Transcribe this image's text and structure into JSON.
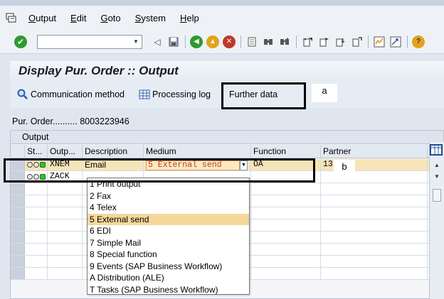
{
  "menu": {
    "items": [
      {
        "label": "Output",
        "u": "O",
        "rest": "utput"
      },
      {
        "label": "Edit",
        "u": "E",
        "rest": "dit"
      },
      {
        "label": "Goto",
        "u": "G",
        "rest": "oto"
      },
      {
        "label": "System",
        "u": "S",
        "rest": "ystem"
      },
      {
        "label": "Help",
        "u": "H",
        "rest": "elp"
      }
    ]
  },
  "toolbar": {
    "command_value": "",
    "icons": [
      "enter-icon",
      "back-icon",
      "save-icon",
      "back-nav-icon",
      "exit-icon",
      "cancel-icon",
      "print-icon",
      "find-icon",
      "find-next-icon",
      "first-page-icon",
      "previous-page-icon",
      "next-page-icon",
      "last-page-icon",
      "create-session-icon",
      "shortcut-icon",
      "help-icon"
    ]
  },
  "screen": {
    "title": "Display Pur. Order :: Output",
    "buttons": {
      "communication": "Communication method",
      "processing_log": "Processing log",
      "further_data": "Further data"
    }
  },
  "annotations": {
    "a": "a",
    "b": "b"
  },
  "po": {
    "label": "Pur. Order..........",
    "number": "8003223946"
  },
  "grid": {
    "title": "Output",
    "columns": [
      "St...",
      "Outp...",
      "Description",
      "Medium",
      "Function",
      "Partner"
    ],
    "rows": [
      {
        "output": "XNEM",
        "description": "Email",
        "medium": "5 External send",
        "function": "OA",
        "partner": "13"
      },
      {
        "output": "ZACK",
        "description": "",
        "medium": "",
        "function": "",
        "partner": ""
      }
    ]
  },
  "dropdown": {
    "options": [
      "1 Print output",
      "2 Fax",
      "4 Telex",
      "5 External send",
      "6 EDI",
      "7 Simple Mail",
      "8 Special function",
      "9 Events (SAP Business Workflow)",
      "A Distribution (ALE)",
      "T Tasks (SAP Business Workflow)"
    ],
    "selected": "5 External send"
  }
}
